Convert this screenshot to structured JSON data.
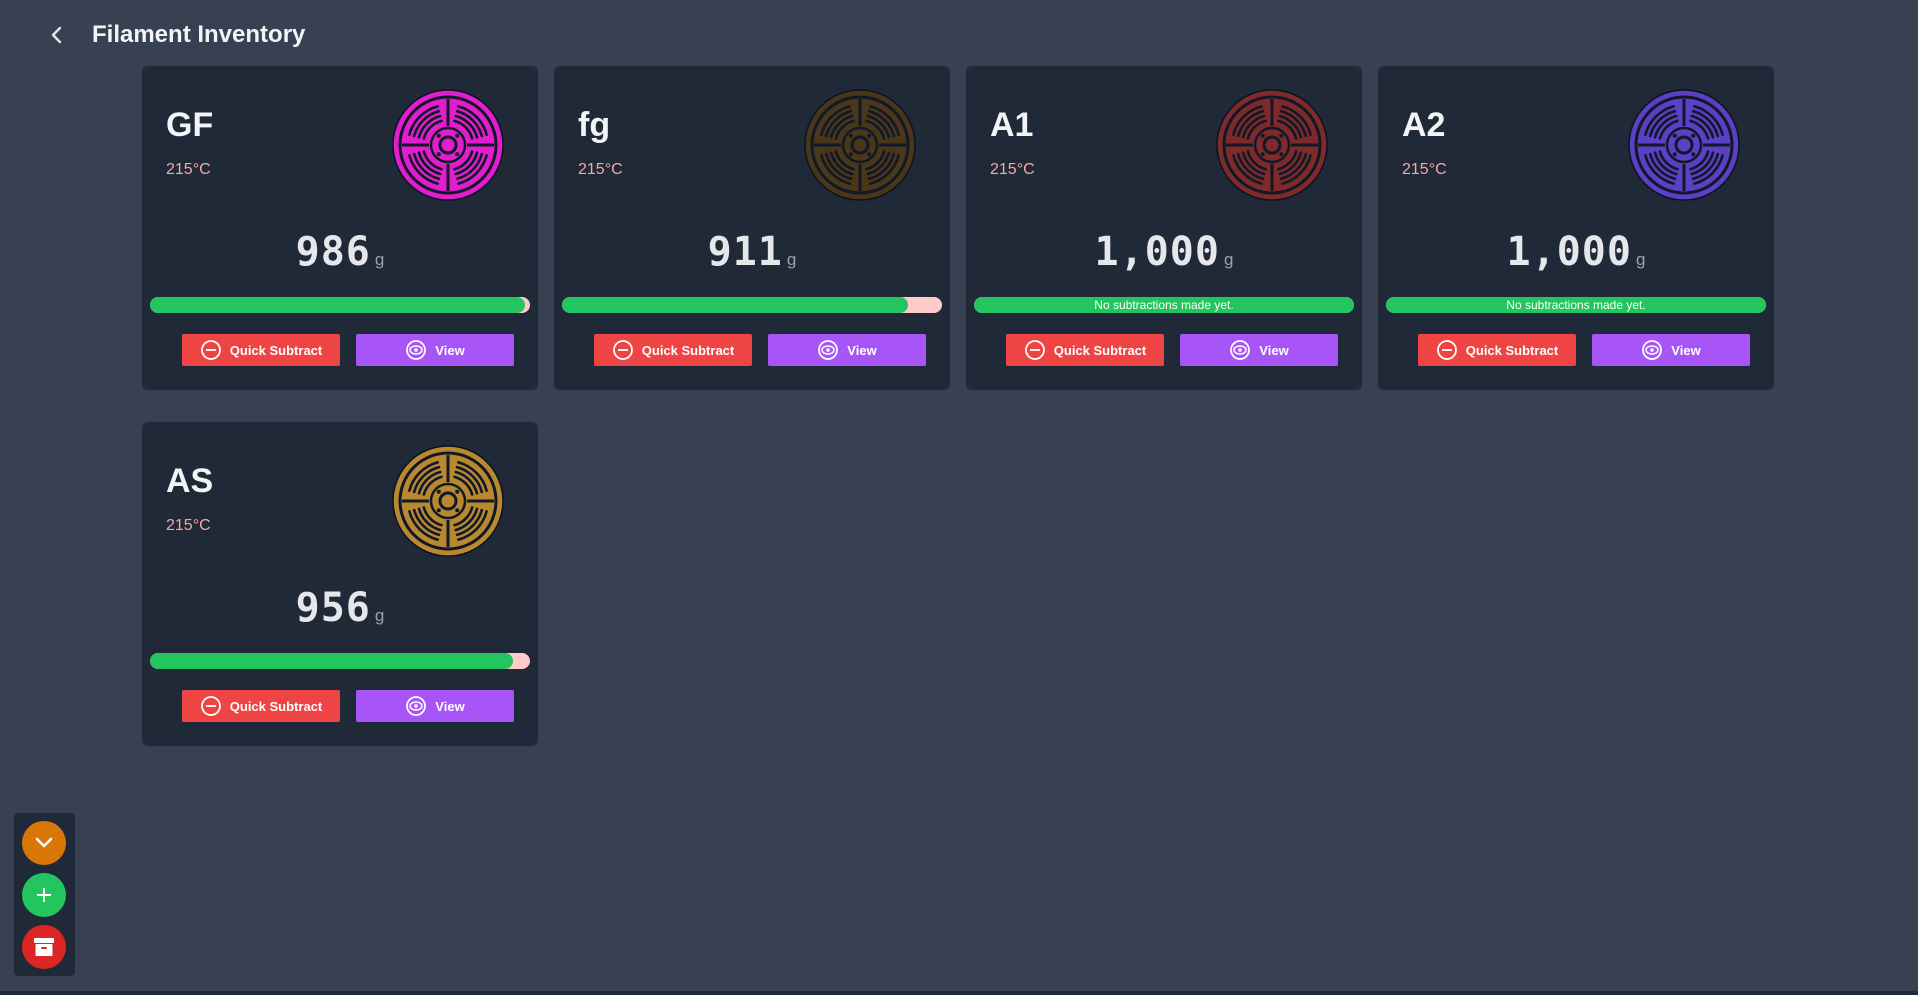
{
  "header": {
    "title": "Filament Inventory",
    "back_icon": "chevron-left-icon"
  },
  "unit": "g",
  "buttons": {
    "quick_subtract": "Quick Subtract",
    "view": "View"
  },
  "spools": [
    {
      "name": "GF",
      "temp": "215°C",
      "weight": "986",
      "remaining_fraction": 0.986,
      "bar_text": "",
      "color": "#e11dcd"
    },
    {
      "name": "fg",
      "temp": "215°C",
      "weight": "911",
      "remaining_fraction": 0.911,
      "bar_text": "",
      "color": "#4a3618"
    },
    {
      "name": "A1",
      "temp": "215°C",
      "weight": "1,000",
      "remaining_fraction": 1.0,
      "bar_text": "No subtractions made yet.",
      "color": "#7f2a2a"
    },
    {
      "name": "A2",
      "temp": "215°C",
      "weight": "1,000",
      "remaining_fraction": 1.0,
      "bar_text": "No subtractions made yet.",
      "color": "#5b3fc4"
    },
    {
      "name": "AS",
      "temp": "215°C",
      "weight": "956",
      "remaining_fraction": 0.956,
      "bar_text": "",
      "color": "#b8892f"
    }
  ],
  "fab": {
    "collapse_icon": "chevron-down-icon",
    "add_icon": "plus-icon",
    "archive_icon": "archive-icon"
  },
  "colors": {
    "background": "#374151",
    "card": "#1f2937",
    "progress_fill": "#22c55e",
    "progress_track": "#fecaca",
    "subtract_button": "#ef4444",
    "view_button": "#a855f7",
    "temp_text": "#fca5a5"
  }
}
